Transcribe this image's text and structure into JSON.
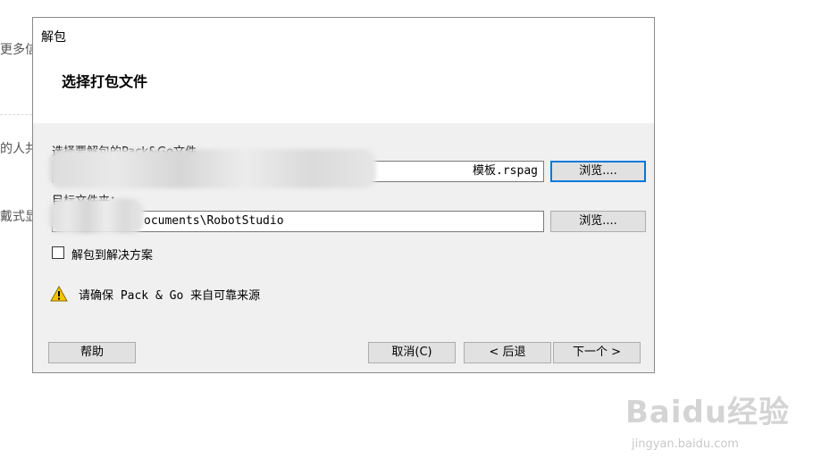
{
  "background": {
    "fragments": [
      "更多信",
      "的人共",
      "戴式显"
    ]
  },
  "dialog": {
    "title": "解包",
    "heading": "选择打包文件",
    "pack_file": {
      "label": "选择要解包的Pack&Go文件",
      "value": "模板.rspag",
      "browse_label": "浏览...."
    },
    "target_folder": {
      "label": "目标文件夹：",
      "value": "ocuments\\RobotStudio",
      "browse_label": "浏览...."
    },
    "solution_checkbox": {
      "label": "解包到解决方案",
      "checked": false
    },
    "warning": {
      "icon": "warning-triangle-icon",
      "text": "请确保 Pack & Go 来自可靠来源"
    },
    "buttons": {
      "help": "帮助",
      "cancel": "取消(C)",
      "back": "< 后退",
      "next": "下一个 >"
    }
  },
  "watermark": {
    "logo": "Baidu经验",
    "url": "jingyan.baidu.com"
  },
  "colors": {
    "dialog_bg": "#f0f0f0",
    "header_bg": "#ffffff",
    "focus_border": "#0078d7",
    "warning_yellow": "#f5c400"
  }
}
